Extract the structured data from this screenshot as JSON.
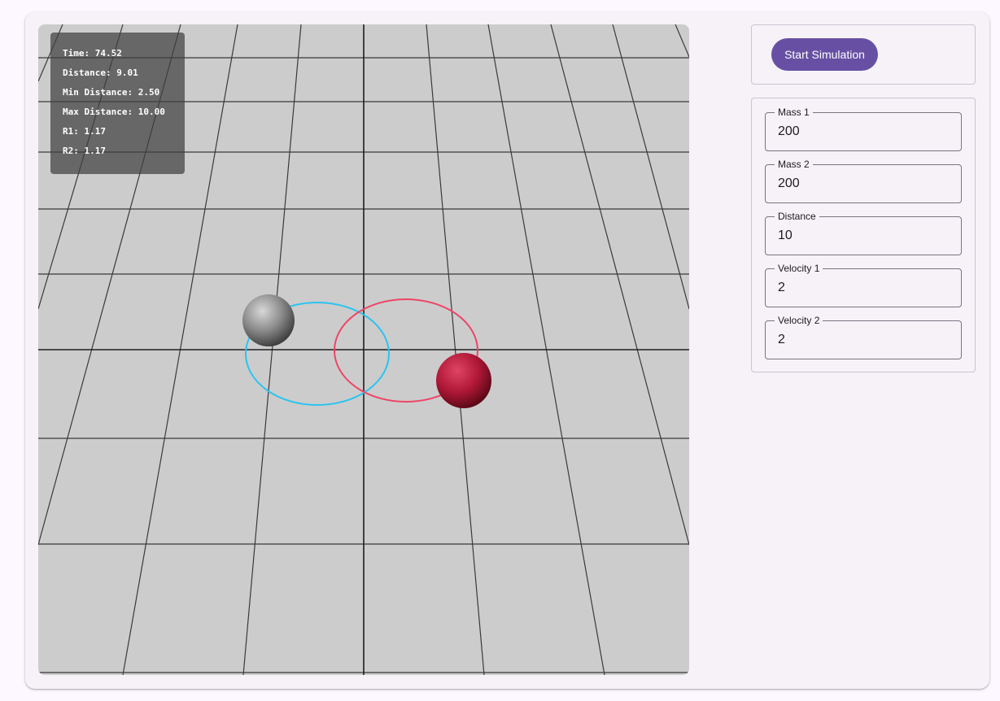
{
  "stats": {
    "time": "Time: 74.52",
    "distance": "Distance: 9.01",
    "min_distance": "Min Distance: 2.50",
    "max_distance": "Max Distance: 10.00",
    "r1": "R1: 1.17",
    "r2": "R2: 1.17"
  },
  "controls": {
    "start_label": "Start Simulation"
  },
  "params": {
    "mass1": {
      "label": "Mass 1",
      "value": "200"
    },
    "mass2": {
      "label": "Mass 2",
      "value": "200"
    },
    "distance": {
      "label": "Distance",
      "value": "10"
    },
    "velocity1": {
      "label": "Velocity 1",
      "value": "2"
    },
    "velocity2": {
      "label": "Velocity 2",
      "value": "2"
    }
  },
  "colors": {
    "accent": "#6750a4",
    "orbit1": "#29c4ee",
    "orbit2": "#ee4466",
    "body1": "#8a8a8a",
    "body2": "#b01838",
    "ground": "#cccccc"
  }
}
